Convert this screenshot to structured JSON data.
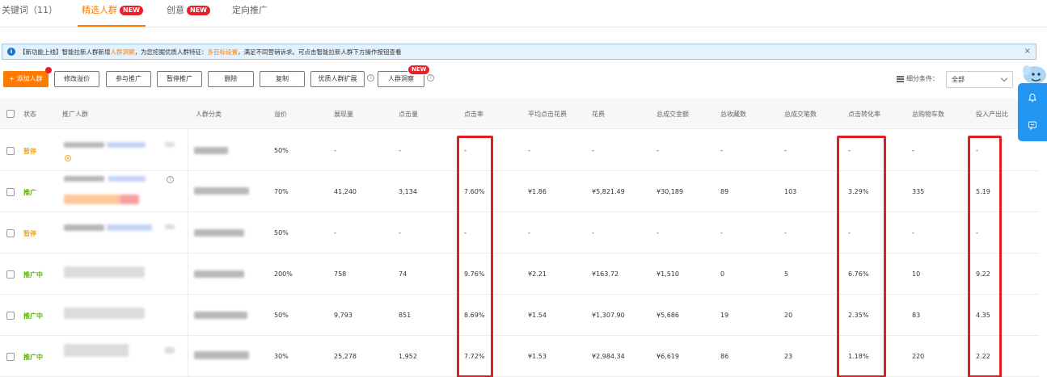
{
  "tabs": [
    {
      "label": "关键词（11）",
      "active": false,
      "badge": ""
    },
    {
      "label": "精选人群",
      "active": true,
      "badge": "NEW"
    },
    {
      "label": "创意",
      "active": false,
      "badge": "NEW"
    },
    {
      "label": "定向推广",
      "active": false,
      "badge": ""
    }
  ],
  "notice": {
    "prefix": "【新功能上线】智能拉新人群新增",
    "link1": "人群洞察",
    "middle": "，为您挖掘优质人群特征：",
    "link2": "多目标设置",
    "suffix": "，满足不同营销诉求。可点击智能拉新人群下方操作按钮查看",
    "close": "×"
  },
  "toolbar": {
    "add": "+ 添加人群",
    "modify_bid": "修改溢价",
    "join": "参与推广",
    "pause": "暂停推广",
    "delete": "删除",
    "copy": "复制",
    "expand": "优质人群扩展",
    "insight": "人群洞察",
    "insight_badge": "NEW",
    "filter_label": "细分条件：",
    "filter_value": "全部"
  },
  "columns": {
    "status": "状态",
    "crowd": "推广人群",
    "category": "人群分类",
    "premium": "溢价",
    "impressions": "展现量",
    "clicks": "点击量",
    "ctr": "点击率",
    "avg_cpc": "平均点击花费",
    "spend": "花费",
    "gmv": "总成交金额",
    "favorites": "总收藏数",
    "orders": "总成交笔数",
    "cvr": "点击转化率",
    "carts": "总购物车数",
    "roi": "投入产出比"
  },
  "rows": [
    {
      "status": "暂停",
      "on": false,
      "premium": "50%",
      "impressions": "-",
      "clicks": "-",
      "ctr": "-",
      "avg_cpc": "-",
      "spend": "-",
      "gmv": "-",
      "favorites": "-",
      "orders": "-",
      "cvr": "-",
      "carts": "-",
      "roi": "-"
    },
    {
      "status": "推广",
      "on": true,
      "premium": "70%",
      "impressions": "41,240",
      "clicks": "3,134",
      "ctr": "7.60%",
      "avg_cpc": "¥1.86",
      "spend": "¥5,821.49",
      "gmv": "¥30,189",
      "favorites": "89",
      "orders": "103",
      "cvr": "3.29%",
      "carts": "335",
      "roi": "5.19"
    },
    {
      "status": "暂停",
      "on": false,
      "premium": "50%",
      "impressions": "-",
      "clicks": "-",
      "ctr": "-",
      "avg_cpc": "-",
      "spend": "-",
      "gmv": "-",
      "favorites": "-",
      "orders": "-",
      "cvr": "-",
      "carts": "-",
      "roi": "-"
    },
    {
      "status": "推广中",
      "on": true,
      "premium": "200%",
      "impressions": "758",
      "clicks": "74",
      "ctr": "9.76%",
      "avg_cpc": "¥2.21",
      "spend": "¥163.72",
      "gmv": "¥1,510",
      "favorites": "0",
      "orders": "5",
      "cvr": "6.76%",
      "carts": "10",
      "roi": "9.22"
    },
    {
      "status": "推广中",
      "on": true,
      "premium": "50%",
      "impressions": "9,793",
      "clicks": "851",
      "ctr": "8.69%",
      "avg_cpc": "¥1.54",
      "spend": "¥1,307.90",
      "gmv": "¥5,686",
      "favorites": "19",
      "orders": "20",
      "cvr": "2.35%",
      "carts": "83",
      "roi": "4.35"
    },
    {
      "status": "推广中",
      "on": true,
      "premium": "30%",
      "impressions": "25,278",
      "clicks": "1,952",
      "ctr": "7.72%",
      "avg_cpc": "¥1.53",
      "spend": "¥2,984.34",
      "gmv": "¥6,619",
      "favorites": "86",
      "orders": "23",
      "cvr": "1.18%",
      "carts": "220",
      "roi": "2.22"
    }
  ],
  "colors": {
    "accent": "#ff7a00",
    "new_badge": "#e8202c",
    "highlight_box": "#e02020",
    "status_on": "#5cb000",
    "status_paused": "#f5a623",
    "side_panel": "#2196f3"
  },
  "icons": [
    "info-icon",
    "close-icon",
    "question-icon",
    "filter-icon",
    "chevron-down-icon",
    "bell-icon",
    "chat-icon",
    "mascot-icon"
  ]
}
